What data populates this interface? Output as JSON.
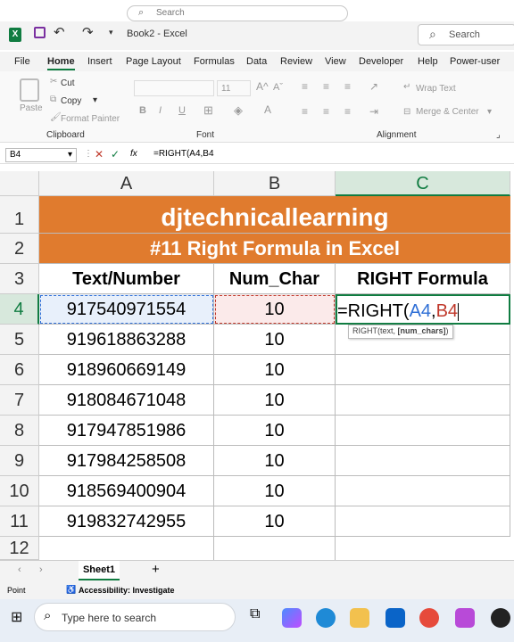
{
  "window": {
    "title": "Book2 - Excel",
    "search_top": "Search",
    "search": "Search"
  },
  "menu": [
    "File",
    "Home",
    "Insert",
    "Page Layout",
    "Formulas",
    "Data",
    "Review",
    "View",
    "Developer",
    "Help",
    "Power-user"
  ],
  "ribbon": {
    "paste": "Paste",
    "cut": "Cut",
    "copy": "Copy",
    "format_painter": "Format Painter",
    "clipboard": "Clipboard",
    "font_size": "11",
    "font": "Font",
    "wrap_text": "Wrap Text",
    "merge_center": "Merge & Center",
    "alignment": "Alignment",
    "bold": "B",
    "italic": "I",
    "underline": "U"
  },
  "formula_bar": {
    "namebox": "B4",
    "fx": "fx",
    "formula": "=RIGHT(A4,B4"
  },
  "columns": [
    "A",
    "B",
    "C"
  ],
  "rows": [
    "1",
    "2",
    "3",
    "4",
    "5",
    "6",
    "7",
    "8",
    "9",
    "10",
    "11",
    "12"
  ],
  "banner": {
    "title": "djtechnicallearning",
    "subtitle": "#11 Right Formula in Excel"
  },
  "headers": {
    "a": "Text/Number",
    "b": "Num_Char",
    "c": "RIGHT Formula"
  },
  "data": [
    {
      "a": "917540971554",
      "b": "10"
    },
    {
      "a": "919618863288",
      "b": "10"
    },
    {
      "a": "918960669149",
      "b": "10"
    },
    {
      "a": "918084671048",
      "b": "10"
    },
    {
      "a": "917947851986",
      "b": "10"
    },
    {
      "a": "917984258508",
      "b": "10"
    },
    {
      "a": "918569400904",
      "b": "10"
    },
    {
      "a": "919832742955",
      "b": "10"
    }
  ],
  "edit": {
    "prefix": "=RIGHT(",
    "ref1": "A4",
    "comma": ",",
    "ref2": "B4"
  },
  "tooltip": {
    "fn": "RIGHT(text, ",
    "arg": "[num_chars]",
    "close": ")"
  },
  "sheet_tab": "Sheet1",
  "status": {
    "mode": "Point",
    "accessibility": "Accessibility: Investigate"
  },
  "taskbar": {
    "search": "Type here to search"
  },
  "colors": {
    "banner": "#e07b2e",
    "ref1": "#2f6fd6",
    "ref2": "#c0392b",
    "excel_green": "#107c41"
  }
}
